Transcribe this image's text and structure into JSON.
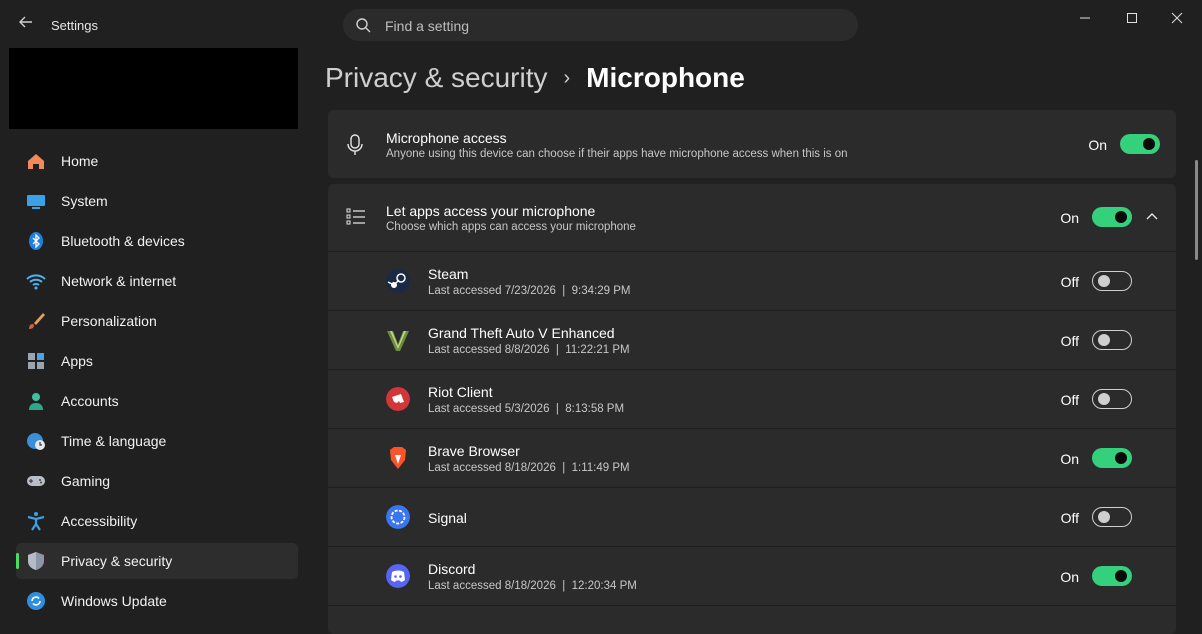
{
  "window": {
    "title": "Settings",
    "search_placeholder": "Find a setting"
  },
  "sidebar": {
    "items": [
      {
        "label": "Home",
        "icon": "home-icon"
      },
      {
        "label": "System",
        "icon": "system-icon"
      },
      {
        "label": "Bluetooth & devices",
        "icon": "bluetooth-icon"
      },
      {
        "label": "Network & internet",
        "icon": "wifi-icon"
      },
      {
        "label": "Personalization",
        "icon": "brush-icon"
      },
      {
        "label": "Apps",
        "icon": "apps-icon"
      },
      {
        "label": "Accounts",
        "icon": "accounts-icon"
      },
      {
        "label": "Time & language",
        "icon": "globe-clock-icon"
      },
      {
        "label": "Gaming",
        "icon": "gamepad-icon"
      },
      {
        "label": "Accessibility",
        "icon": "accessibility-icon"
      },
      {
        "label": "Privacy & security",
        "icon": "shield-icon",
        "active": true
      },
      {
        "label": "Windows Update",
        "icon": "update-icon"
      }
    ]
  },
  "breadcrumb": {
    "parent": "Privacy & security",
    "separator": "›",
    "current": "Microphone"
  },
  "mic_access": {
    "title": "Microphone access",
    "subtitle": "Anyone using this device can choose if their apps have microphone access when this is on",
    "state": "On",
    "enabled": true
  },
  "apps_access": {
    "title": "Let apps access your microphone",
    "subtitle": "Choose which apps can access your microphone",
    "state": "On",
    "enabled": true,
    "apps": [
      {
        "name": "Steam",
        "last_accessed": "Last accessed 7/23/2026  |  9:34:29 PM",
        "state": "Off",
        "enabled": false,
        "icon": "steam-icon"
      },
      {
        "name": "Grand Theft Auto V Enhanced",
        "last_accessed": "Last accessed 8/8/2026  |  11:22:21 PM",
        "state": "Off",
        "enabled": false,
        "icon": "gta-icon"
      },
      {
        "name": "Riot Client",
        "last_accessed": "Last accessed 5/3/2026  |  8:13:58 PM",
        "state": "Off",
        "enabled": false,
        "icon": "riot-icon"
      },
      {
        "name": "Brave Browser",
        "last_accessed": "Last accessed 8/18/2026  |  1:11:49 PM",
        "state": "On",
        "enabled": true,
        "icon": "brave-icon"
      },
      {
        "name": "Signal",
        "last_accessed": "",
        "state": "Off",
        "enabled": false,
        "icon": "signal-icon"
      },
      {
        "name": "Discord",
        "last_accessed": "Last accessed 8/18/2026  |  12:20:34 PM",
        "state": "On",
        "enabled": true,
        "icon": "discord-icon"
      }
    ]
  },
  "colors": {
    "accent": "#34d07b",
    "background": "#202020",
    "card": "#2b2b2b"
  }
}
